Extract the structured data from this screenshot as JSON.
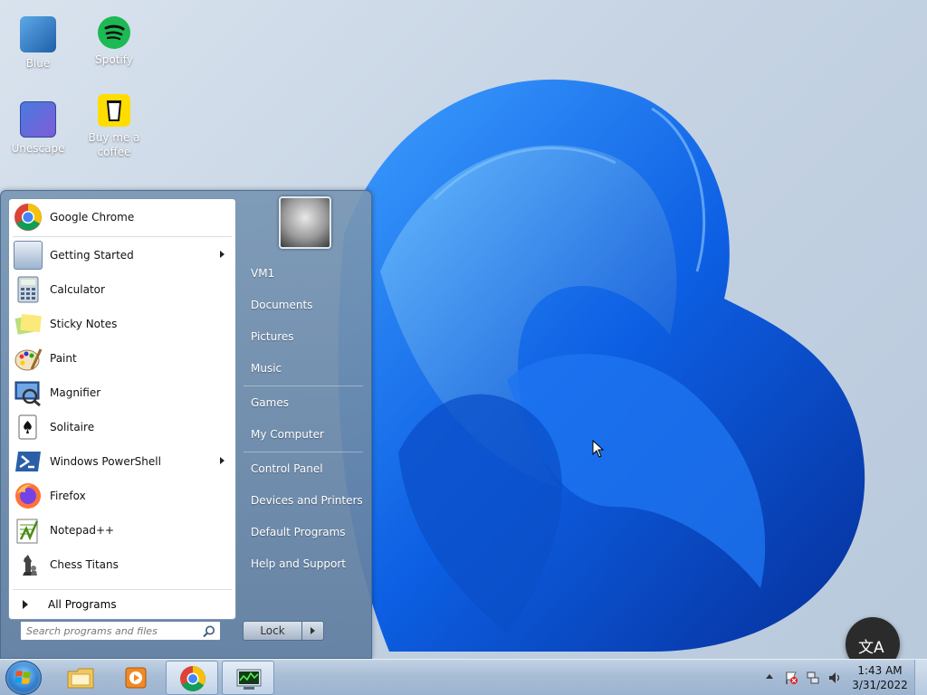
{
  "desktop": {
    "icons": [
      {
        "label": "Blue"
      },
      {
        "label": "Spotify"
      },
      {
        "label": "Unescape"
      },
      {
        "label": "Buy me a coffee"
      }
    ]
  },
  "start_menu": {
    "programs": [
      {
        "label": "Google Chrome",
        "icon": "chrome-icon",
        "submenu": false
      },
      {
        "label": "Getting Started",
        "icon": "getting-started-icon",
        "submenu": true
      },
      {
        "label": "Calculator",
        "icon": "calculator-icon",
        "submenu": false
      },
      {
        "label": "Sticky Notes",
        "icon": "sticky-notes-icon",
        "submenu": false
      },
      {
        "label": "Paint",
        "icon": "paint-icon",
        "submenu": false
      },
      {
        "label": "Magnifier",
        "icon": "magnifier-icon",
        "submenu": false
      },
      {
        "label": "Solitaire",
        "icon": "solitaire-icon",
        "submenu": false
      },
      {
        "label": "Windows PowerShell",
        "icon": "powershell-icon",
        "submenu": true
      },
      {
        "label": "Firefox",
        "icon": "firefox-icon",
        "submenu": false
      },
      {
        "label": "Notepad++",
        "icon": "notepadpp-icon",
        "submenu": false
      },
      {
        "label": "Chess Titans",
        "icon": "chess-icon",
        "submenu": false
      }
    ],
    "all_programs_label": "All Programs",
    "search_placeholder": "Search programs and files",
    "right_items": [
      {
        "label": "VM1"
      },
      {
        "label": "Documents"
      },
      {
        "label": "Pictures"
      },
      {
        "label": "Music"
      },
      {
        "label": "Games"
      },
      {
        "label": "My Computer"
      },
      {
        "label": "Control Panel"
      },
      {
        "label": "Devices and Printers"
      },
      {
        "label": "Default Programs"
      },
      {
        "label": "Help and Support"
      }
    ],
    "lock_label": "Lock"
  },
  "taskbar": {
    "pinned": [
      {
        "icon": "file-explorer-icon",
        "active": false
      },
      {
        "icon": "media-player-icon",
        "active": false
      },
      {
        "icon": "chrome-icon",
        "active": true
      },
      {
        "icon": "task-manager-icon",
        "active": true
      }
    ],
    "clock": {
      "time": "1:43 AM",
      "date": "3/31/2022"
    }
  },
  "translate_glyph": "文A",
  "colors": {
    "accent": "#1e6fe0",
    "taskbar": "#a8bdd6"
  }
}
